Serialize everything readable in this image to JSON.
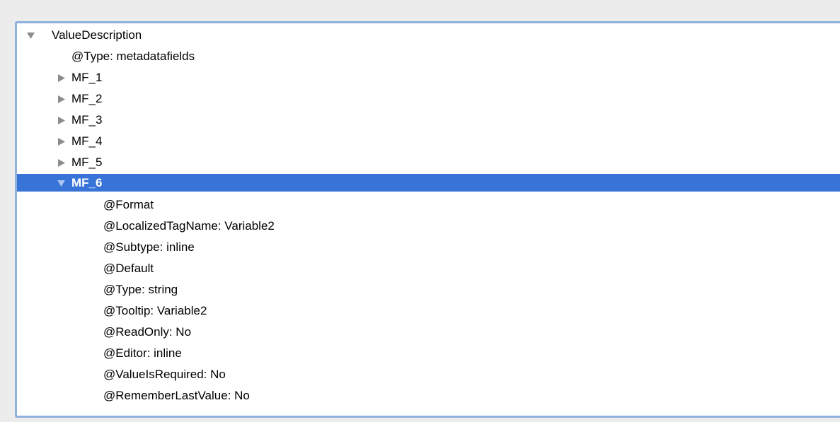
{
  "tree": {
    "root": {
      "label": "ValueDescription",
      "expanded": true
    },
    "root_children": [
      {
        "label": "@Type: metadatafields",
        "kind": "attribute"
      },
      {
        "label": "MF_1",
        "kind": "node",
        "expanded": false
      },
      {
        "label": "MF_2",
        "kind": "node",
        "expanded": false
      },
      {
        "label": "MF_3",
        "kind": "node",
        "expanded": false
      },
      {
        "label": "MF_4",
        "kind": "node",
        "expanded": false
      },
      {
        "label": "MF_5",
        "kind": "node",
        "expanded": false
      },
      {
        "label": "MF_6",
        "kind": "node",
        "expanded": true,
        "selected": true
      }
    ],
    "mf6_children": [
      "@Format",
      "@LocalizedTagName: Variable2",
      "@Subtype: inline",
      "@Default",
      "@Type: string",
      "@Tooltip: Variable2",
      "@ReadOnly: No",
      "@Editor: inline",
      "@ValueIsRequired: No",
      "@RememberLastValue: No"
    ]
  },
  "colors": {
    "selection": "#3874d8",
    "focus_border": "#8eb1de",
    "disclosure_gray": "#8c8c8c"
  },
  "icons": {
    "collapsed": "disclosure-triangle-right-icon",
    "expanded": "disclosure-triangle-down-icon"
  }
}
